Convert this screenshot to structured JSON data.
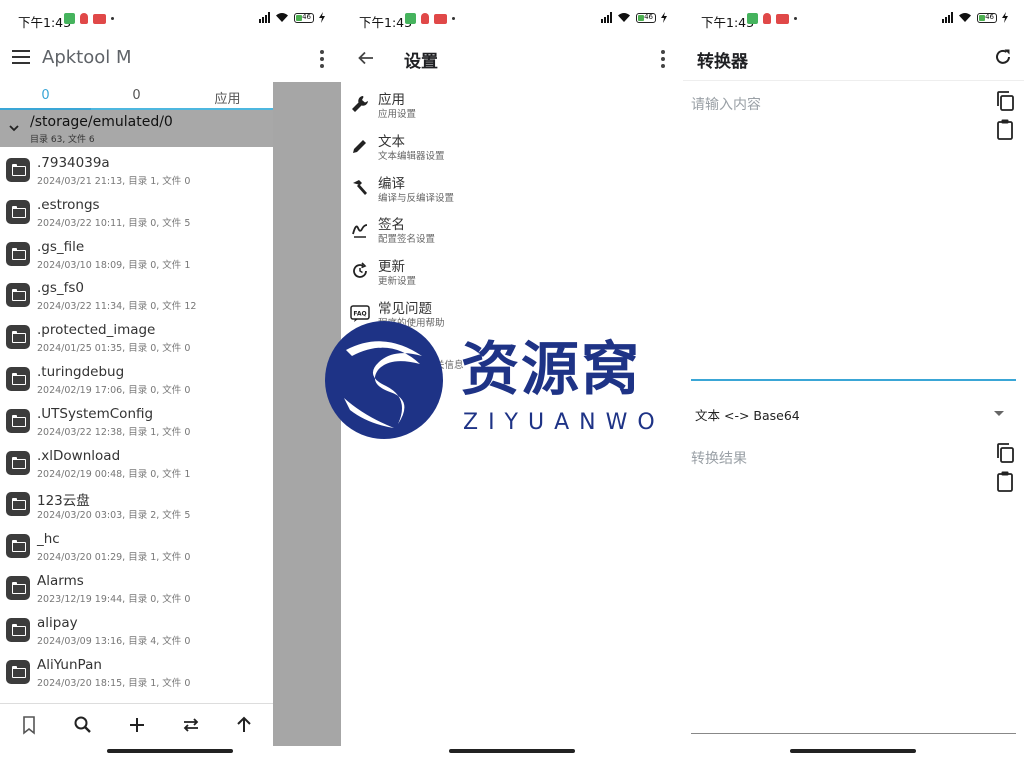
{
  "status": {
    "time": "下午1:43",
    "battery": "46"
  },
  "panel1": {
    "title": "Apktool M",
    "tabs": [
      "0",
      "0",
      "应用"
    ],
    "path": "/storage/emulated/0",
    "path_meta": "目录 63, 文件 6",
    "files": [
      {
        "name": ".7934039a",
        "meta": "2024/03/21 21:13, 目录 1, 文件 0"
      },
      {
        "name": ".estrongs",
        "meta": "2024/03/22 10:11, 目录 0, 文件 5"
      },
      {
        "name": ".gs_file",
        "meta": "2024/03/10 18:09, 目录 0, 文件 1"
      },
      {
        "name": ".gs_fs0",
        "meta": "2024/03/22 11:34, 目录 0, 文件 12"
      },
      {
        "name": ".protected_image",
        "meta": "2024/01/25 01:35, 目录 0, 文件 0"
      },
      {
        "name": ".turingdebug",
        "meta": "2024/02/19 17:06, 目录 0, 文件 0"
      },
      {
        "name": ".UTSystemConfig",
        "meta": "2024/03/22 12:38, 目录 1, 文件 0"
      },
      {
        "name": ".xlDownload",
        "meta": "2024/02/19 00:48, 目录 0, 文件 1"
      },
      {
        "name": "123云盘",
        "meta": "2024/03/20 03:03, 目录 2, 文件 5"
      },
      {
        "name": "_hc",
        "meta": "2024/03/20 01:29, 目录 1, 文件 0"
      },
      {
        "name": "Alarms",
        "meta": "2023/12/19 19:44, 目录 0, 文件 0"
      },
      {
        "name": "alipay",
        "meta": "2024/03/09 13:16, 目录 4, 文件 0"
      },
      {
        "name": "AliYunPan",
        "meta": "2024/03/20 18:15, 目录 1, 文件 0"
      }
    ],
    "bottom_icons": [
      "bookmark-icon",
      "search-icon",
      "add-icon",
      "swap-icon",
      "arrow-up-icon"
    ]
  },
  "panel2": {
    "title": "设置",
    "items": [
      {
        "title": "应用",
        "sub": "应用设置",
        "icon": "wrench-icon"
      },
      {
        "title": "文本",
        "sub": "文本编辑器设置",
        "icon": "pencil-icon"
      },
      {
        "title": "编译",
        "sub": "编译与反编译设置",
        "icon": "hammer-icon"
      },
      {
        "title": "签名",
        "sub": "配置签名设置",
        "icon": "signature-icon"
      },
      {
        "title": "更新",
        "sub": "更新设置",
        "icon": "update-icon"
      },
      {
        "title": "常见问题",
        "sub": "程序的使用帮助",
        "icon": "faq-icon"
      },
      {
        "title": "",
        "sub": "关于作者和相关信息",
        "icon": "help-icon"
      }
    ]
  },
  "panel3": {
    "title": "转换器",
    "input_placeholder": "请输入内容",
    "mode": "文本 <-> Base64",
    "result_placeholder": "转换结果"
  },
  "watermark": {
    "text": "资源窝",
    "sub": "ZIYUANWO",
    "color": "#1e3386"
  }
}
